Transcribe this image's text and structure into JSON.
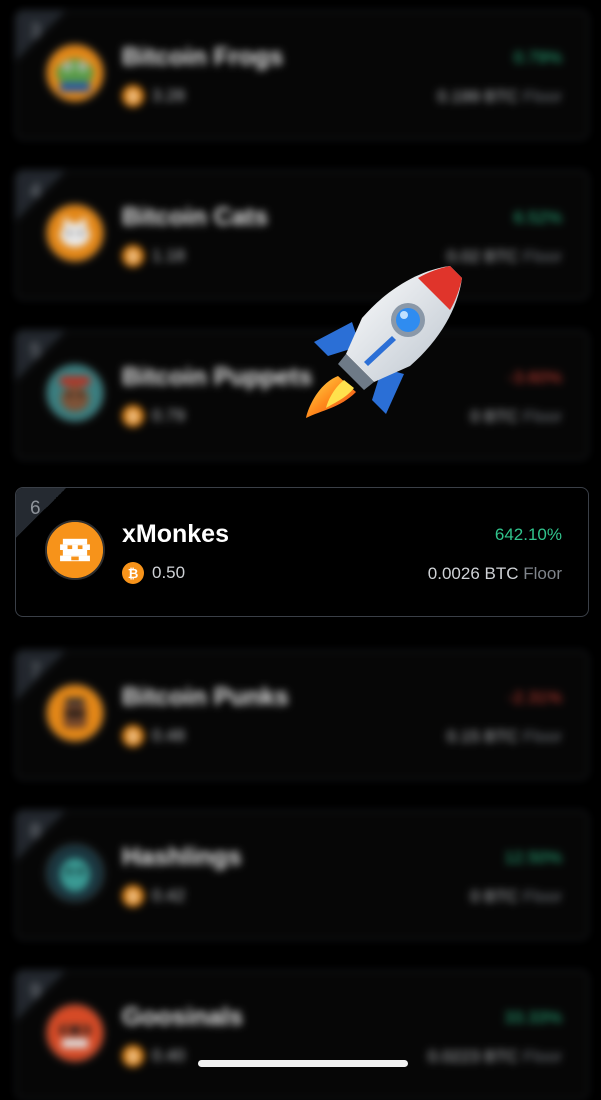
{
  "collections": [
    {
      "rank": "3",
      "name": "Bitcoin Frogs",
      "change": "0.79%",
      "trend": "up",
      "value": "3.28",
      "floor": "0.199 BTC",
      "floor_label": "Floor",
      "avatar": "frog-avatar",
      "focused": false
    },
    {
      "rank": "4",
      "name": "Bitcoin Cats",
      "change": "6.52%",
      "trend": "up",
      "value": "1.18",
      "floor": "0.02 BTC",
      "floor_label": "Floor",
      "avatar": "cat-avatar",
      "focused": false
    },
    {
      "rank": "5",
      "name": "Bitcoin Puppets",
      "change": "-3.60%",
      "trend": "down",
      "value": "0.79",
      "floor": "0 BTC",
      "floor_label": "Floor",
      "avatar": "puppet-avatar",
      "focused": false
    },
    {
      "rank": "6",
      "name": "xMonkes",
      "change": "642.10%",
      "trend": "up",
      "value": "0.50",
      "floor": "0.0026 BTC",
      "floor_label": "Floor",
      "avatar": "monke-avatar",
      "focused": true
    },
    {
      "rank": "7",
      "name": "Bitcoin Punks",
      "change": "-2.31%",
      "trend": "down",
      "value": "0.48",
      "floor": "0.15 BTC",
      "floor_label": "Floor",
      "avatar": "punk-avatar",
      "focused": false
    },
    {
      "rank": "8",
      "name": "Hashlings",
      "change": "12.50%",
      "trend": "up",
      "value": "0.42",
      "floor": "0 BTC",
      "floor_label": "Floor",
      "avatar": "hashling-avatar",
      "focused": false
    },
    {
      "rank": "9",
      "name": "Goosinals",
      "change": "33.33%",
      "trend": "up",
      "value": "0.40",
      "floor": "0.0223 BTC",
      "floor_label": "Floor",
      "avatar": "goosinal-avatar",
      "focused": false
    }
  ],
  "badge_symbol": "₿",
  "overlay_icon": "rocket-emoji-icon",
  "colors": {
    "up": "#31c48d",
    "down": "#e0453a",
    "bitcoin_orange": "#f7931a",
    "background": "#000000"
  }
}
